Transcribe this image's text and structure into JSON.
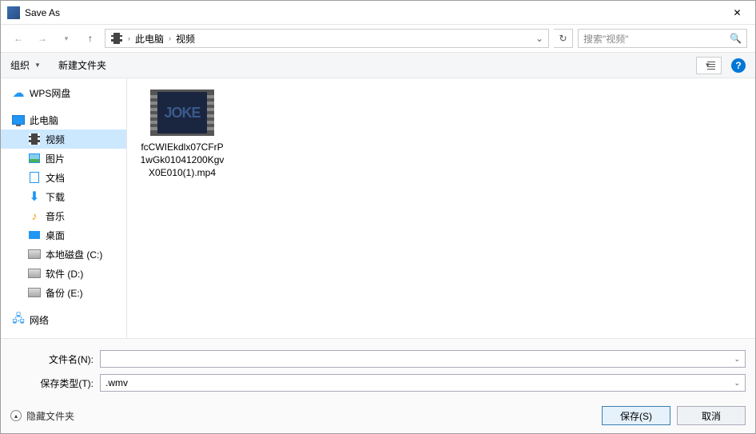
{
  "window": {
    "title": "Save As"
  },
  "breadcrumb": {
    "root": "此电脑",
    "current": "视频"
  },
  "search": {
    "placeholder": "搜索\"视频\""
  },
  "toolbar": {
    "organize": "组织",
    "newFolder": "新建文件夹"
  },
  "sidebar": {
    "wps": "WPS网盘",
    "pc": "此电脑",
    "video": "视频",
    "pictures": "图片",
    "documents": "文档",
    "downloads": "下载",
    "music": "音乐",
    "desktop": "桌面",
    "diskC": "本地磁盘 (C:)",
    "diskD": "软件 (D:)",
    "diskE": "备份 (E:)",
    "network": "网络"
  },
  "content": {
    "file1": "fcCWIEkdlx07CFrP1wGk01041200KgvX0E010(1).mp4",
    "thumbText": "JOKE"
  },
  "form": {
    "filenameLabel": "文件名(N):",
    "filetypeLabel": "保存类型(T):",
    "filetypeValue": ".wmv",
    "hideFolders": "隐藏文件夹",
    "save": "保存(S)",
    "cancel": "取消"
  }
}
